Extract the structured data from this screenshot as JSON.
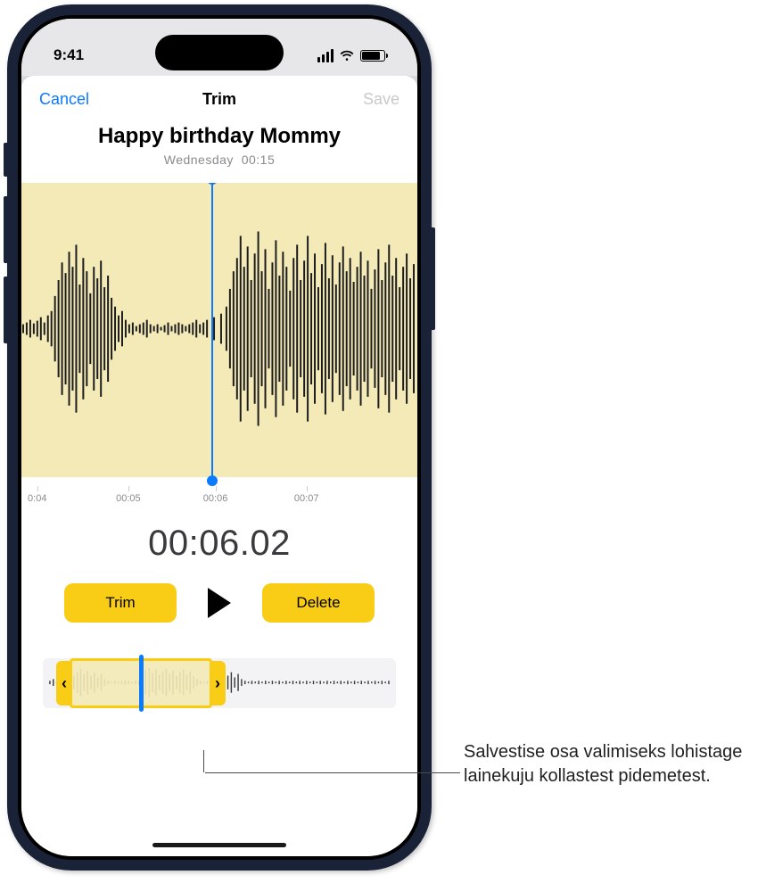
{
  "status": {
    "time": "9:41"
  },
  "nav": {
    "cancel": "Cancel",
    "title": "Trim",
    "save": "Save"
  },
  "recording": {
    "title": "Happy birthday Mommy",
    "day": "Wednesday",
    "duration": "00:15"
  },
  "ruler": {
    "ticks": [
      {
        "pos": 4,
        "label": "0:04"
      },
      {
        "pos": 27,
        "label": "00:05"
      },
      {
        "pos": 49,
        "label": "00:06"
      },
      {
        "pos": 72,
        "label": "00:07"
      }
    ]
  },
  "timecode": "00:06.02",
  "controls": {
    "trim": "Trim",
    "delete": "Delete"
  },
  "callout": "Salvestise osa valimiseks lohistage lainekuju kollastest pidemetest."
}
